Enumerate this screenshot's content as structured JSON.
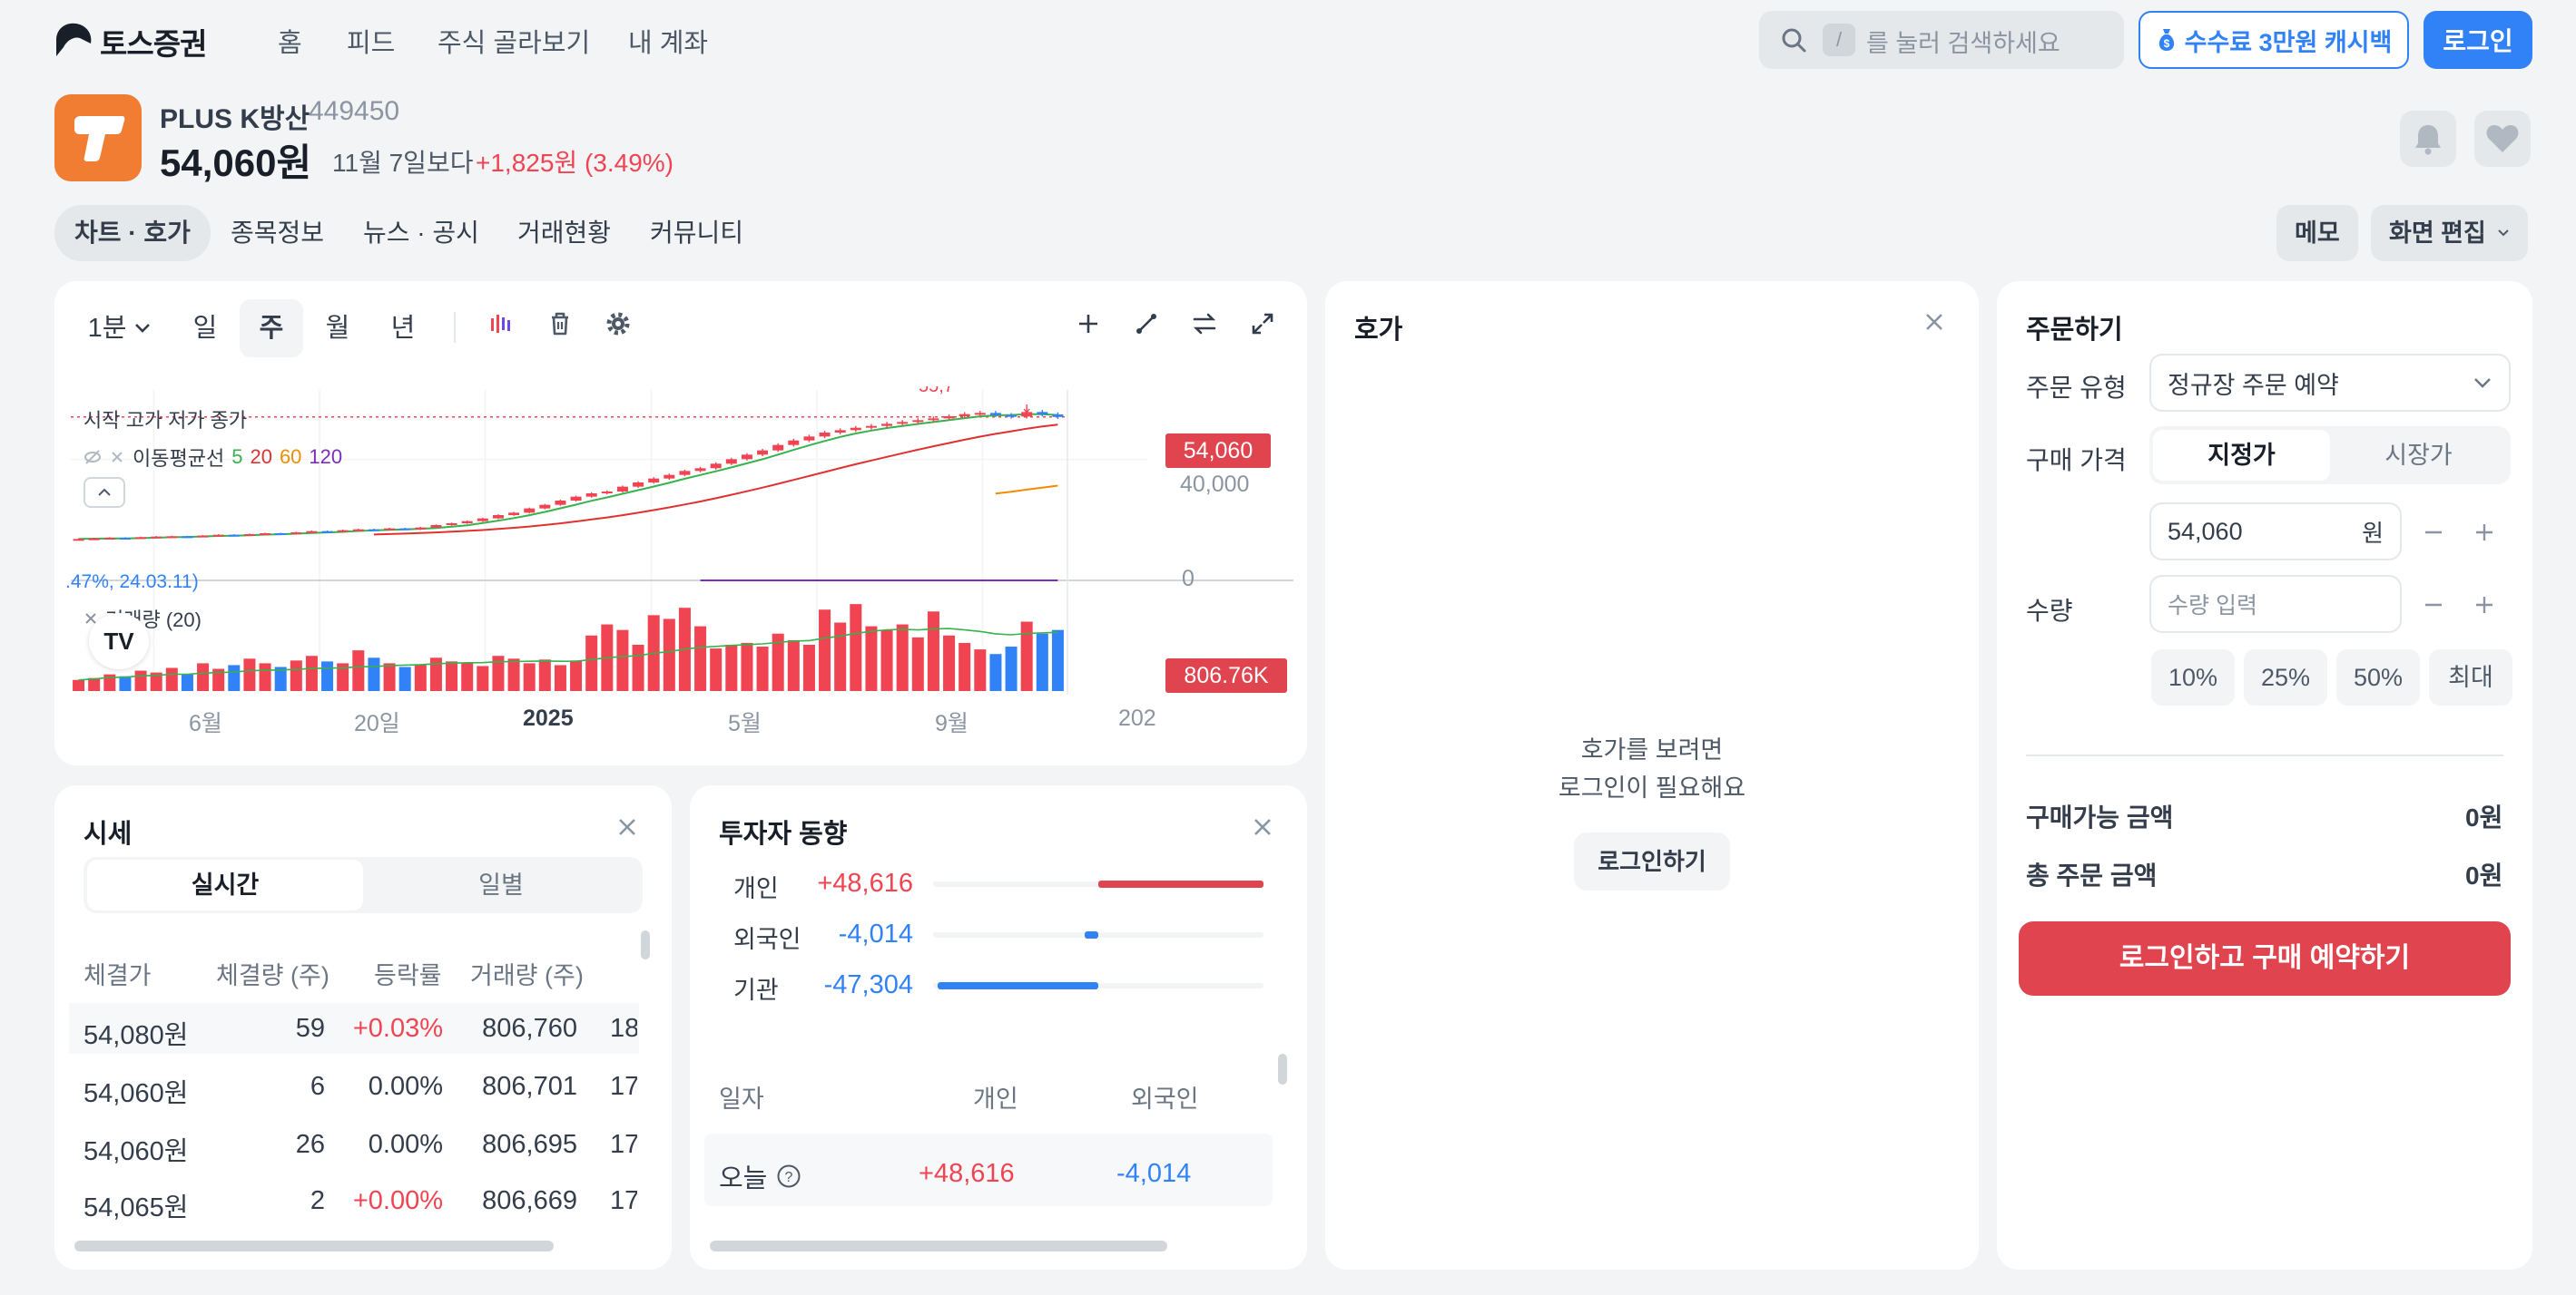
{
  "header": {
    "logo_text": "토스증권",
    "nav": [
      "홈",
      "피드",
      "주식 골라보기",
      "내 계좌"
    ],
    "search_slash": "/",
    "search_placeholder": "를 눌러 검색하세요",
    "cashback_label": "수수료 3만원 캐시백",
    "login_label": "로그인",
    "icons": [
      "search-icon",
      "money-bag-icon",
      "bell-icon",
      "heart-icon"
    ]
  },
  "stock": {
    "name": "PLUS K방산",
    "code": "449450",
    "price": "54,060원",
    "since_label": "11월 7일보다",
    "change": "+1,825원 (3.49%)",
    "logo_color": "#f07d31"
  },
  "tabs": [
    "차트 · 호가",
    "종목정보",
    "뉴스 · 공시",
    "거래현황",
    "커뮤니티"
  ],
  "tab_actions": {
    "memo": "메모",
    "edit_screen": "화면 편집"
  },
  "chart_toolbar": {
    "interval": "1분",
    "periods": [
      "일",
      "주",
      "월",
      "년"
    ],
    "selected_period": "주"
  },
  "chart": {
    "ohlc_label": "시작 고가 저가 종가",
    "ma_label": "이동평균선",
    "ma_periods": [
      {
        "label": "5",
        "color": "#37b24d"
      },
      {
        "label": "20",
        "color": "#e03131"
      },
      {
        "label": "60",
        "color": "#f08c00"
      },
      {
        "label": "120",
        "color": "#7b2cbf"
      }
    ],
    "low_annotation": ".47%, 24.03.11)",
    "high_annotation": "55,7",
    "volume_label": "거래량 (20)",
    "price_tag": "54,060",
    "volume_tag": "806.76K",
    "tv_logo": "TV",
    "y_ticks": [
      "40,000",
      "0"
    ],
    "x_ticks": [
      "6월",
      "20일",
      "2025",
      "5월",
      "9월",
      "202"
    ]
  },
  "chart_data": {
    "type": "candlestick",
    "period": "weekly",
    "close": [
      13700,
      13900,
      14100,
      13900,
      14300,
      14500,
      14600,
      14500,
      14800,
      15100,
      15000,
      15300,
      15600,
      15400,
      15900,
      16300,
      16100,
      16600,
      16900,
      16800,
      17200,
      16900,
      17500,
      18300,
      18900,
      19600,
      20500,
      21600,
      22400,
      23800,
      25000,
      26400,
      27700,
      28800,
      29400,
      31000,
      32400,
      33700,
      34900,
      36200,
      37100,
      38600,
      40100,
      41600,
      43000,
      44800,
      46300,
      47600,
      48900,
      49700,
      50500,
      51100,
      51800,
      52400,
      53000,
      53600,
      54300,
      55000,
      55400,
      54700,
      54200,
      55700,
      54900,
      54060
    ],
    "ma_periods": [
      5,
      20,
      60,
      120
    ],
    "volume_relative": [
      0.12,
      0.14,
      0.18,
      0.16,
      0.22,
      0.2,
      0.25,
      0.18,
      0.3,
      0.24,
      0.28,
      0.35,
      0.3,
      0.26,
      0.33,
      0.38,
      0.32,
      0.3,
      0.44,
      0.36,
      0.3,
      0.26,
      0.28,
      0.36,
      0.32,
      0.3,
      0.27,
      0.38,
      0.35,
      0.3,
      0.34,
      0.28,
      0.33,
      0.6,
      0.72,
      0.66,
      0.5,
      0.82,
      0.78,
      0.9,
      0.7,
      0.46,
      0.5,
      0.52,
      0.48,
      0.62,
      0.55,
      0.5,
      0.88,
      0.74,
      0.94,
      0.7,
      0.66,
      0.72,
      0.58,
      0.86,
      0.6,
      0.52,
      0.45,
      0.4,
      0.48,
      0.75,
      0.62,
      0.66
    ],
    "up_color": "#f04452",
    "down_color": "#3182f6"
  },
  "orderbook": {
    "title": "호가",
    "message_line1": "호가를 보려면",
    "message_line2": "로그인이 필요해요",
    "login_button": "로그인하기"
  },
  "quotes": {
    "title": "시세",
    "tabs": [
      "실시간",
      "일별"
    ],
    "selected_tab": "실시간",
    "columns": [
      "체결가",
      "체결량 (주)",
      "등락률",
      "거래량 (주)"
    ],
    "rows": [
      {
        "price": "54,080원",
        "qty": "59",
        "rate": "+0.03%",
        "rate_type": "up",
        "volume": "806,760",
        "extra": "18"
      },
      {
        "price": "54,060원",
        "qty": "6",
        "rate": "0.00%",
        "rate_type": "flat",
        "volume": "806,701",
        "extra": "17"
      },
      {
        "price": "54,060원",
        "qty": "26",
        "rate": "0.00%",
        "rate_type": "flat",
        "volume": "806,695",
        "extra": "17"
      },
      {
        "price": "54,065원",
        "qty": "2",
        "rate": "+0.00%",
        "rate_type": "up",
        "volume": "806,669",
        "extra": "17"
      }
    ]
  },
  "investors": {
    "title": "투자자 동향",
    "items": [
      {
        "name": "개인",
        "value": "+48,616",
        "dir": "up",
        "magnitude": 48616
      },
      {
        "name": "외국인",
        "value": "-4,014",
        "dir": "down",
        "magnitude": 4014
      },
      {
        "name": "기관",
        "value": "-47,304",
        "dir": "down",
        "magnitude": 47304
      }
    ],
    "columns": [
      "일자",
      "개인",
      "외국인"
    ],
    "row": {
      "date": "오늘",
      "individual": "+48,616",
      "foreign": "-4,014"
    }
  },
  "order": {
    "title": "주문하기",
    "type_label": "주문 유형",
    "type_value": "정규장 주문 예약",
    "price_label": "구매 가격",
    "price_modes": [
      "지정가",
      "시장가"
    ],
    "selected_price_mode": "지정가",
    "price_value": "54,060",
    "price_unit": "원",
    "qty_label": "수량",
    "qty_placeholder": "수량 입력",
    "percents": [
      "10%",
      "25%",
      "50%",
      "최대"
    ],
    "available_label": "구매가능 금액",
    "available_value": "0원",
    "total_label": "총 주문 금액",
    "total_value": "0원",
    "cta": "로그인하고 구매 예약하기"
  }
}
